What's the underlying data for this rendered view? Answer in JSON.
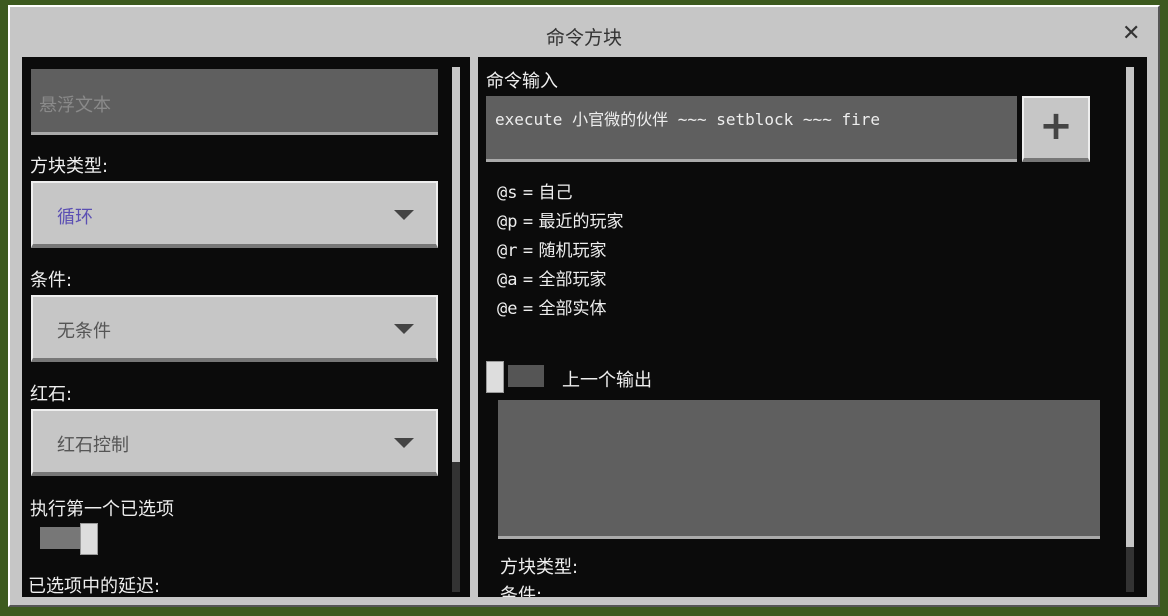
{
  "window": {
    "title": "命令方块",
    "close_icon": "close-icon"
  },
  "left": {
    "hover_text_placeholder": "悬浮文本",
    "block_type_label": "方块类型:",
    "block_type_value": "循环",
    "condition_label": "条件:",
    "condition_value": "无条件",
    "redstone_label": "红石:",
    "redstone_value": "红石控制",
    "execute_first_label": "执行第一个已选项",
    "execute_first_on": true,
    "delay_label": "已选项中的延迟:"
  },
  "right": {
    "command_label": "命令输入",
    "command_value": "execute 小官微的伙伴 ~~~ setblock ~~~ fire",
    "plus_label": "+",
    "selectors": [
      {
        "key": "@s",
        "eq": "=",
        "desc": "自己"
      },
      {
        "key": "@p",
        "eq": "=",
        "desc": "最近的玩家"
      },
      {
        "key": "@r",
        "eq": "=",
        "desc": "随机玩家"
      },
      {
        "key": "@a",
        "eq": "=",
        "desc": "全部玩家"
      },
      {
        "key": "@e",
        "eq": "=",
        "desc": "全部实体"
      }
    ],
    "previous_output_label": "上一个输出",
    "previous_output_on": false,
    "block_type_label": "方块类型:",
    "condition_label": "条件:"
  },
  "colors": {
    "accent_value": "#5b4fb3",
    "panel": "#0b0b0b",
    "window": "#c6c6c6"
  }
}
